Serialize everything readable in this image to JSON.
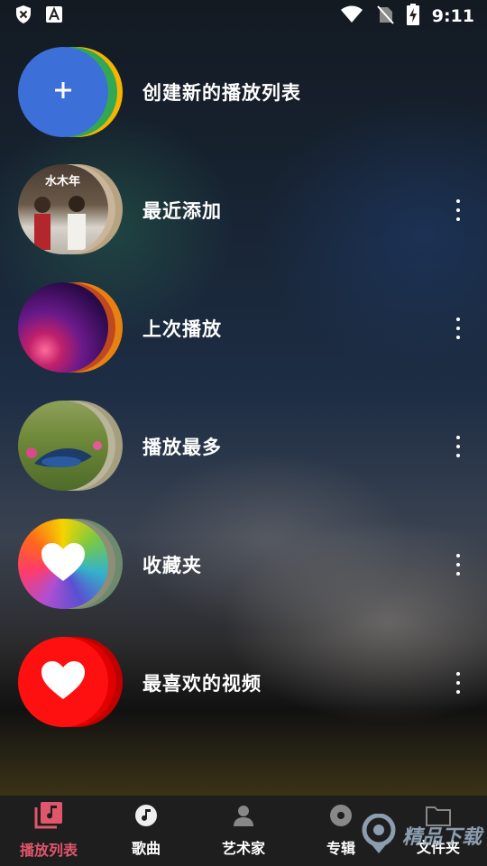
{
  "status_bar": {
    "time": "9:11",
    "left_icons": [
      "shield-x-icon",
      "font-a-icon"
    ],
    "right_icons": [
      "wifi-icon",
      "no-sim-icon",
      "battery-charging-icon"
    ]
  },
  "playlists": [
    {
      "label": "创建新的播放列表",
      "kind": "create",
      "colors": [
        "#3d6fd8",
        "#33a853",
        "#f6b400"
      ]
    },
    {
      "label": "最近添加",
      "kind": "cover",
      "colors": [
        "#c8b59a",
        "#b7a381"
      ]
    },
    {
      "label": "上次播放",
      "kind": "cover",
      "colors": [
        "#e78112",
        "#c04820"
      ]
    },
    {
      "label": "播放最多",
      "kind": "cover",
      "colors": [
        "#b9b49a",
        "#a59f7f"
      ]
    },
    {
      "label": "收藏夹",
      "kind": "heart-rainbow",
      "colors": [
        "#8c8e76",
        "#6d8a6f"
      ]
    },
    {
      "label": "最喜欢的视频",
      "kind": "heart-red",
      "colors": [
        "#d90000",
        "#e00000"
      ]
    }
  ],
  "covers": {
    "recent_title_text": "水木年"
  },
  "bottom_nav": {
    "active_color": "#e0566a",
    "tabs": [
      {
        "label": "播放列表",
        "icon": "playlist-icon"
      },
      {
        "label": "歌曲",
        "icon": "music-note-icon"
      },
      {
        "label": "艺术家",
        "icon": "artist-icon"
      },
      {
        "label": "专辑",
        "icon": "album-icon"
      },
      {
        "label": "文件夹",
        "icon": "folder-icon"
      }
    ]
  },
  "watermark": {
    "text": "精品下载"
  }
}
